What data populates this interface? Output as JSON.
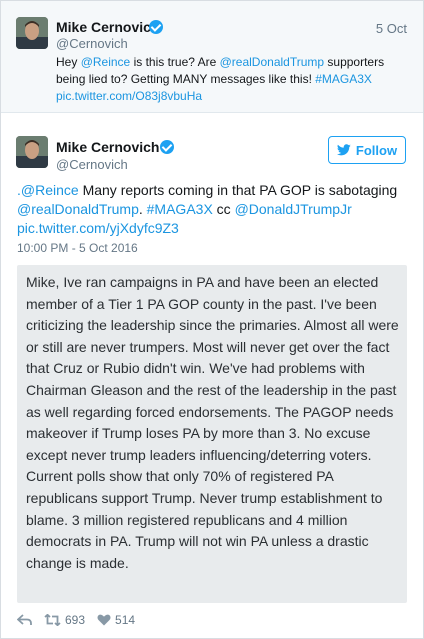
{
  "reply_tweet": {
    "name": "Mike Cernovich",
    "handle": "@Cernovich",
    "date": "5 Oct",
    "text": [
      {
        "t": "Hey ",
        "link": false
      },
      {
        "t": "@Reince",
        "link": true
      },
      {
        "t": " is this true? Are ",
        "link": false
      },
      {
        "t": "@realDonaldTrump",
        "link": true
      },
      {
        "t": " supporters being lied to? Getting MANY messages like this! ",
        "link": false
      },
      {
        "t": "#MAGA3X",
        "link": true
      },
      {
        "t": " ",
        "link": false
      },
      {
        "t": "pic.twitter.com/O83j8vbuHa",
        "link": true
      }
    ]
  },
  "main_tweet": {
    "name": "Mike Cernovich",
    "handle": "@Cernovich",
    "follow_label": "Follow",
    "text": [
      {
        "t": ".@Reince",
        "link": true
      },
      {
        "t": " Many reports coming in that PA GOP is sabotaging ",
        "link": false
      },
      {
        "t": "@realDonaldTrump",
        "link": true
      },
      {
        "t": ". ",
        "link": false
      },
      {
        "t": "#MAGA3X",
        "link": true
      },
      {
        "t": " cc ",
        "link": false
      },
      {
        "t": "@DonaldJTrumpJr",
        "link": true
      },
      {
        "t": " ",
        "link": false
      },
      {
        "t": "pic.twitter.com/yjXdyfc9Z3",
        "link": true
      }
    ],
    "timestamp": "10:00 PM - 5 Oct 2016",
    "image_text": "Mike, Ive ran campaigns in PA and have been an elected member of a Tier 1 PA GOP county in the past. I've been criticizing the leadership since the primaries. Almost all were or still are never trumpers. Most will never get over the fact that Cruz or Rubio didn't win. We've had problems with Chairman Gleason and the rest of the leadership in the past as well regarding forced endorsements. The PAGOP needs makeover if Trump loses PA by more than 3. No excuse except never trump leaders influencing/deterring voters. Current polls show that only 70% of registered PA republicans support Trump. Never trump establishment to blame. 3 million registered republicans and 4 million democrats in PA. Trump will not win PA unless a drastic change is made.",
    "retweets": "693",
    "likes": "514"
  },
  "colors": {
    "link": "#1b95e0",
    "verified": "#1da1f2",
    "muted": "#657786",
    "reply_bg": "#f5f8fa",
    "card_bg": "#e8ebed"
  },
  "icons": [
    "verified-badge-icon",
    "twitter-bird-icon",
    "reply-icon",
    "retweet-icon",
    "heart-icon"
  ]
}
